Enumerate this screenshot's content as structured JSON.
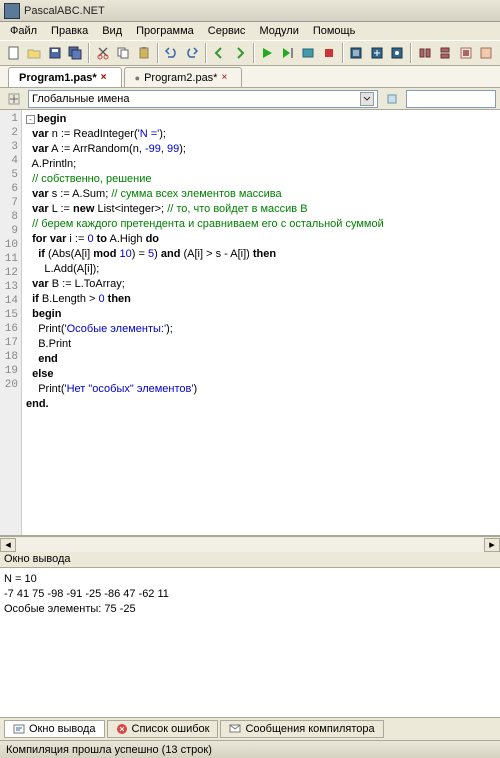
{
  "window": {
    "title": "PascalABC.NET"
  },
  "menu": {
    "file": "Файл",
    "edit": "Правка",
    "view": "Вид",
    "program": "Программа",
    "service": "Сервис",
    "modules": "Модули",
    "help": "Помощь"
  },
  "tabs": {
    "t1": "Program1.pas*",
    "t2": "Program2.pas*"
  },
  "nav": {
    "globals": "Глобальные имена"
  },
  "code_lines": {
    "l1": "begin",
    "l2a": "  var",
    "l2b": " n := ReadInteger(",
    "l2c": "'N ='",
    "l2d": ");",
    "l3a": "  var",
    "l3b": " A := ArrRandom(n, ",
    "l3c": "-99",
    "l3d": ", ",
    "l3e": "99",
    "l3f": ");",
    "l4": "  A.Println;",
    "l5": "  // собственно, решение",
    "l6a": "  var",
    "l6b": " s := A.Sum; ",
    "l6c": "// сумма всех элементов массива",
    "l7a": "  var",
    "l7b": " L := ",
    "l7c": "new",
    "l7d": " List<integer>; ",
    "l7e": "// то, что войдет в массив B",
    "l8": "  // берем каждого претендента и сравниваем его с остальной суммой",
    "l9a": "  for var",
    "l9b": " i := ",
    "l9c": "0",
    "l9d": " to",
    "l9e": " A.High ",
    "l9f": "do",
    "l10a": "    if",
    "l10b": " (Abs(A[i] ",
    "l10c": "mod",
    "l10d": " ",
    "l10e": "10",
    "l10f": ") = ",
    "l10g": "5",
    "l10h": ") ",
    "l10i": "and",
    "l10j": " (A[i] > s - A[i]) ",
    "l10k": "then",
    "l11": "      L.Add(A[i]);",
    "l12a": "  var",
    "l12b": " B := L.ToArray;",
    "l13a": "  if",
    "l13b": " B.Length > ",
    "l13c": "0",
    "l13d": " then",
    "l14": "  begin",
    "l15a": "    Print(",
    "l15b": "'Особые элементы:'",
    "l15c": ");",
    "l16": "    B.Print",
    "l17": "    end",
    "l18": "  else",
    "l19a": "    Print(",
    "l19b": "'Нет \"особых\" элементов'",
    "l19c": ")",
    "l20": "end."
  },
  "output": {
    "label": "Окно вывода",
    "line1": "N = 10",
    "line2": "-7 41 75 -98 -91 -25 -86 47 -62 11",
    "line3": "Особые элементы: 75 -25"
  },
  "bottom_tabs": {
    "t1": "Окно вывода",
    "t2": "Список ошибок",
    "t3": "Сообщения компилятора"
  },
  "status": {
    "text": "Компиляция прошла успешно (13 строк)"
  }
}
